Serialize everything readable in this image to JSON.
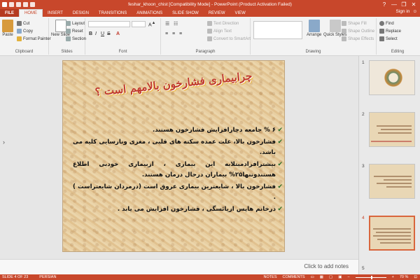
{
  "window": {
    "title": "feshar_khoon_chist [Compatibility Mode] - PowerPoint (Product Activation Failed)",
    "controls": [
      "?",
      "—",
      "❐",
      "✕"
    ]
  },
  "tabs": [
    {
      "label": "FILE"
    },
    {
      "label": "HOME"
    },
    {
      "label": "INSERT"
    },
    {
      "label": "DESIGN"
    },
    {
      "label": "TRANSITIONS"
    },
    {
      "label": "ANIMATIONS"
    },
    {
      "label": "SLIDE SHOW"
    },
    {
      "label": "REVIEW"
    },
    {
      "label": "VIEW"
    }
  ],
  "signin": "Sign in",
  "ribbon": {
    "clipboard": {
      "label": "Clipboard",
      "paste": "Paste",
      "cut": "Cut",
      "copy": "Copy",
      "format_painter": "Format Painter"
    },
    "slides": {
      "label": "Slides",
      "new_slide": "New Slide",
      "layout": "Layout",
      "reset": "Reset",
      "section": "Section"
    },
    "font": {
      "label": "Font"
    },
    "paragraph": {
      "label": "Paragraph",
      "text_direction": "Text Direction",
      "align_text": "Align Text",
      "convert_smartart": "Convert to SmartArt"
    },
    "drawing": {
      "label": "Drawing",
      "arrange": "Arrange",
      "quick_styles": "Quick Styles",
      "shape_fill": "Shape Fill",
      "shape_outline": "Shape Outline",
      "shape_effects": "Shape Effects"
    },
    "editing": {
      "label": "Editing",
      "find": "Find",
      "replace": "Replace",
      "select": "Select"
    }
  },
  "slide": {
    "title": "چرابیماری فشارخون بالامهم است ؟",
    "bullets": [
      "۶ % جامعه دچارافزایش فشارخون هستند.",
      "فشارخون بالا، علت عمده سکته های قلبی ، مغزی ونارسایی کلیه می باشد.",
      "بیشترافرادمبتلابه این بیماری ، ازبیماری خودبی اطلاع هستندوتنها۲۵% بیماران درحال درمان هستند.",
      "فشارخون بالا ، شایعترین بیماری عروق است (درمردان شایعتراست ) .",
      "درخانم هاپس ازیائسگی ، فشارخون افزایش می یابد ."
    ]
  },
  "thumbnails": [
    {
      "num": "1",
      "title": ""
    },
    {
      "num": "2",
      "title": ""
    },
    {
      "num": "3",
      "title": ""
    },
    {
      "num": "4",
      "title": ""
    },
    {
      "num": "5",
      "title": ""
    }
  ],
  "notes_placeholder": "Click to add notes",
  "status": {
    "slide": "SLIDE 4 OF 23",
    "language": "PERSIAN",
    "notes": "NOTES",
    "comments": "COMMENTS",
    "zoom": "70 %"
  },
  "colors": {
    "accent": "#c8472b",
    "title_red": "#c0392b"
  }
}
